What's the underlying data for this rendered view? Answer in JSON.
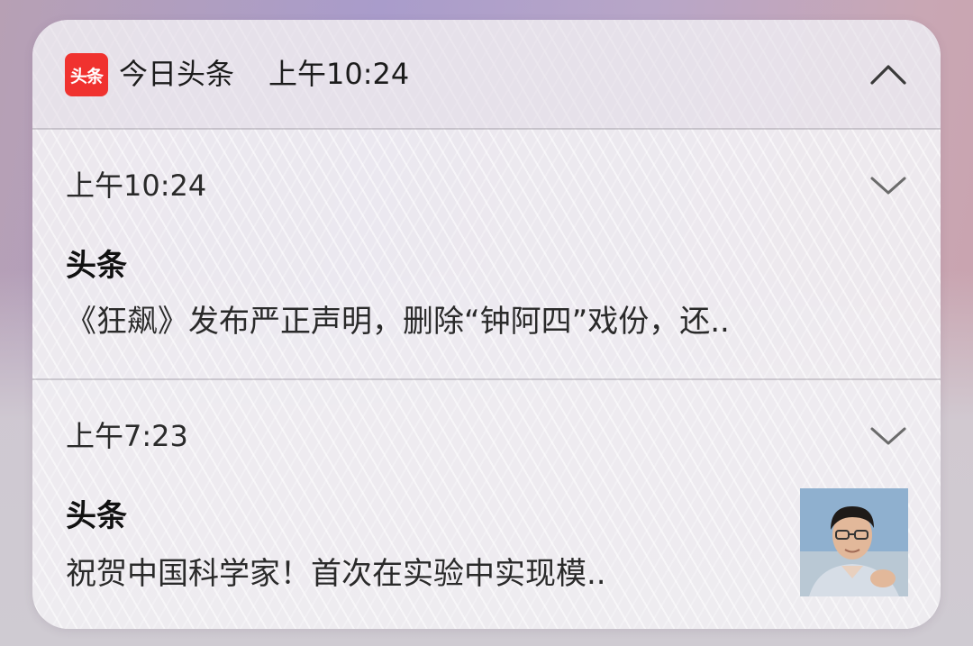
{
  "app": {
    "name": "今日头条",
    "logo_text": "头条",
    "time": "上午10:24",
    "brand_color": "#f0322f"
  },
  "notifications": [
    {
      "time": "上午10:24",
      "title": "头条",
      "body": "《狂飙》发布严正声明，删除“钟阿四”戏份，还.."
    },
    {
      "time": "上午7:23",
      "title": "头条",
      "body": "祝贺中国科学家！首次在实验中实现模.."
    }
  ],
  "icons": {
    "collapse": "chevron-up-icon",
    "expand": "chevron-down-icon"
  }
}
